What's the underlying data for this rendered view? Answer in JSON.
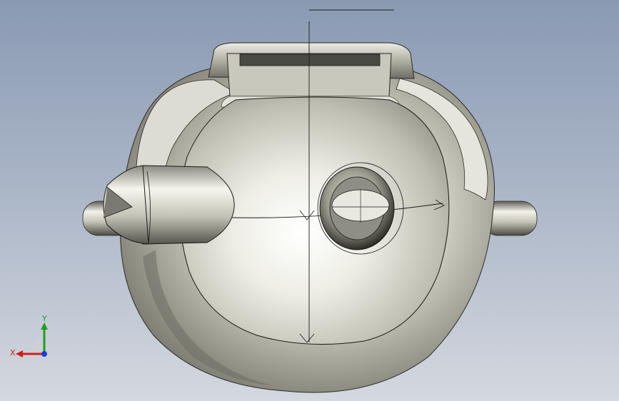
{
  "viewport": {
    "background_top": "#8a9ab3",
    "background_bottom": "#d4d8df"
  },
  "model": {
    "body_color": "#c9c9bd",
    "edge_color": "#1a1a1a"
  },
  "triad": {
    "x_label": "X",
    "y_label": "Y",
    "x_color": "#d21e1e",
    "y_color": "#1ea01e",
    "z_color": "#1e3cd2"
  }
}
